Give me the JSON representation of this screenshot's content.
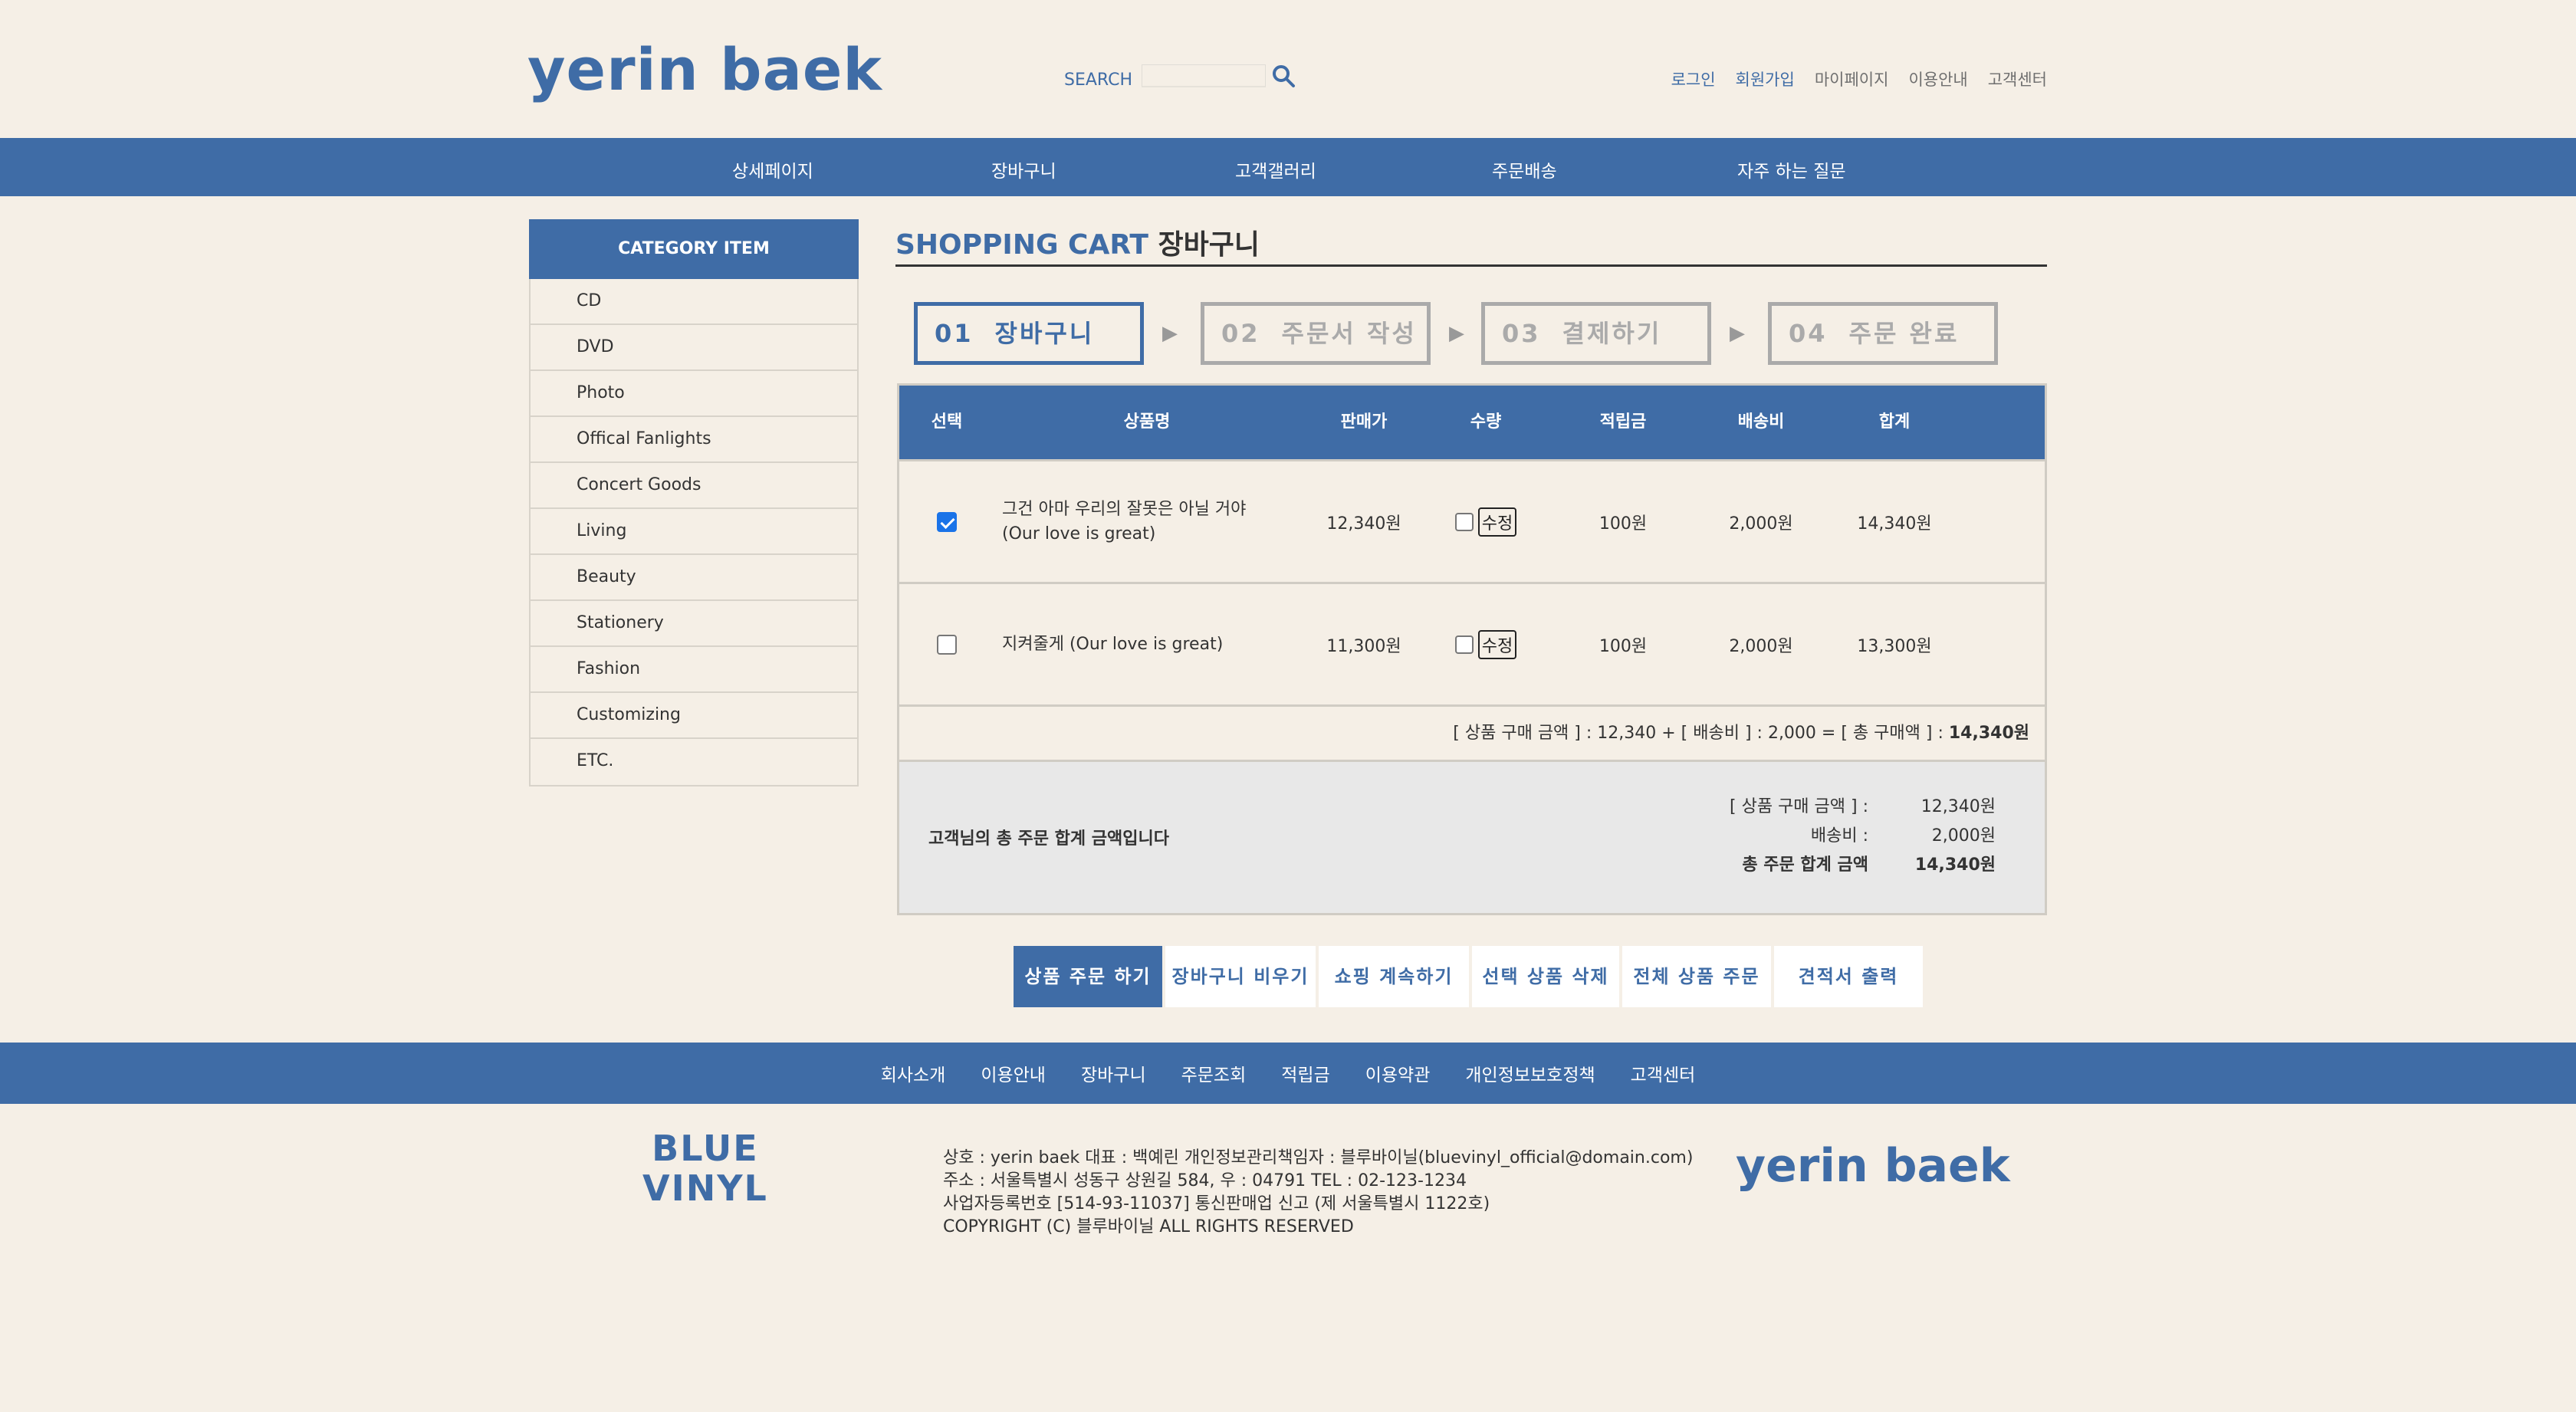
{
  "header": {
    "logo": "yerin baek",
    "search_label": "SEARCH",
    "search_placeholder": "",
    "links": [
      "로그인",
      "회원가입",
      "마이페이지",
      "이용안내",
      "고객센터"
    ]
  },
  "nav": {
    "items": [
      "상세페이지",
      "장바구니",
      "고객갤러리",
      "주문배송",
      "자주 하는 질문"
    ]
  },
  "sidebar": {
    "title": "CATEGORY ITEM",
    "items": [
      "CD",
      "DVD",
      "Photo",
      "Offical Fanlights",
      "Concert Goods",
      "Living",
      "Beauty",
      "Stationery",
      "Fashion",
      "Customizing",
      "ETC."
    ]
  },
  "main": {
    "title_en": "SHOPPING CART",
    "title_ko": "장바구니",
    "steps": [
      {
        "num": "01",
        "label": "장바구니"
      },
      {
        "num": "02",
        "label": "주문서 작성"
      },
      {
        "num": "03",
        "label": "결제하기"
      },
      {
        "num": "04",
        "label": "주문 완료"
      }
    ],
    "columns": [
      "선택",
      "상품명",
      "판매가",
      "수량",
      "적립금",
      "배송비",
      "합계"
    ],
    "rows": [
      {
        "checked": true,
        "name": "그건 아마 우리의 잘못은 아닐 거야 (Our love is great)",
        "price": "12,340원",
        "edit": "수정",
        "points": "100원",
        "shipping": "2,000원",
        "total": "14,340원"
      },
      {
        "checked": false,
        "name": "지켜줄게 (Our love is great)",
        "price": "11,300원",
        "edit": "수정",
        "points": "100원",
        "shipping": "2,000원",
        "total": "13,300원"
      }
    ],
    "summary_text": "[ 상품 구매 금액 ] : 12,340 + [ 배송비 ] : 2,000 = [ 총 구매액 ] : ",
    "summary_total": "14,340원",
    "total_box": {
      "label": "고객님의 총 주문 합계 금액입니다",
      "lines": [
        {
          "key": "[ 상품 구매 금액 ] :",
          "value": "12,340원"
        },
        {
          "key": "배송비 :",
          "value": "2,000원"
        },
        {
          "key": "총 주문 합계 금액",
          "value": "14,340원"
        }
      ]
    },
    "buttons": [
      "상품 주문 하기",
      "장바구니 비우기",
      "쇼핑 계속하기",
      "선택 상품 삭제",
      "전체 상품 주문",
      "견적서 출력"
    ]
  },
  "footer": {
    "nav": [
      "회사소개",
      "이용안내",
      "장바구니",
      "주문조회",
      "적립금",
      "이용약관",
      "개인정보보호정책",
      "고객센터"
    ],
    "brand_line1": "BLUE",
    "brand_line2": "VINYL",
    "info": [
      "상호 : yerin baek 대표 : 백예린 개인정보관리책임자 : 블루바이닐(bluevinyl_official@domain.com)",
      "주소 : 서울특별시 성동구 상원길 584, 우 : 04791 TEL : 02-123-1234",
      "사업자등록번호 [514-93-11037] 통신판매업 신고 (제 서울특별시 1122호)",
      "COPYRIGHT (C) 블루바이닐 ALL RIGHTS RESERVED"
    ],
    "logo": "yerin baek"
  },
  "colors": {
    "brand_blue": "#3f6ca6",
    "background": "#f5efe6",
    "total_box_bg": "#e8e8e8"
  }
}
